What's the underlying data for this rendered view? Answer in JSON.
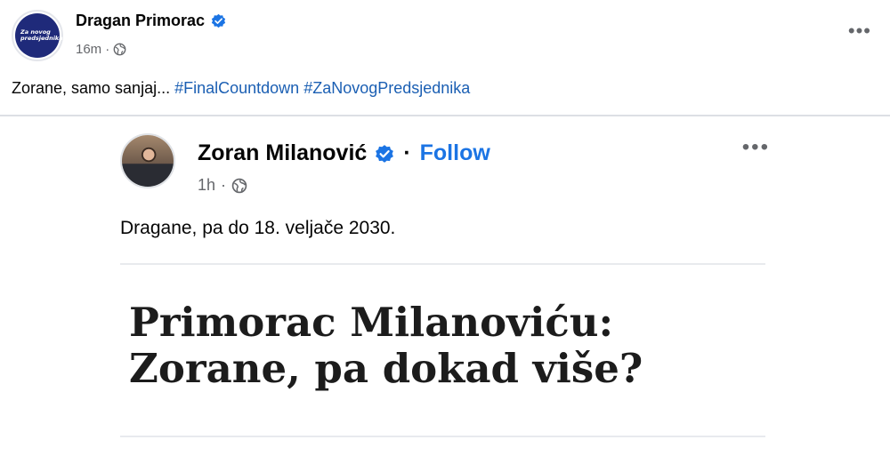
{
  "post": {
    "author": "Dragan Primorac",
    "time": "16m",
    "separator": "·",
    "avatar_text": [
      "Za novog",
      "predsjednika"
    ],
    "text": "Zorane, samo sanjaj... ",
    "hashtags": [
      "#FinalCountdown",
      "#ZaNovogPredsjednika"
    ],
    "more_label": "•••"
  },
  "shared_post": {
    "author": "Zoran Milanović",
    "separator": "·",
    "follow_label": "Follow",
    "time": "1h",
    "text": "Dragane, pa do 18. veljače 2030.",
    "more_label": "•••",
    "headline_line1": "Primorac Milanoviću:",
    "headline_line2": "Zorane, pa dokad više?"
  },
  "colors": {
    "verified": "#1b74e4",
    "hashtag": "#1b5fb3",
    "follow": "#1b74e4",
    "secondary_text": "#65676b"
  },
  "icons": {
    "verified": "verified-badge-icon",
    "audience": "globe-icon",
    "more": "more-options-icon"
  }
}
